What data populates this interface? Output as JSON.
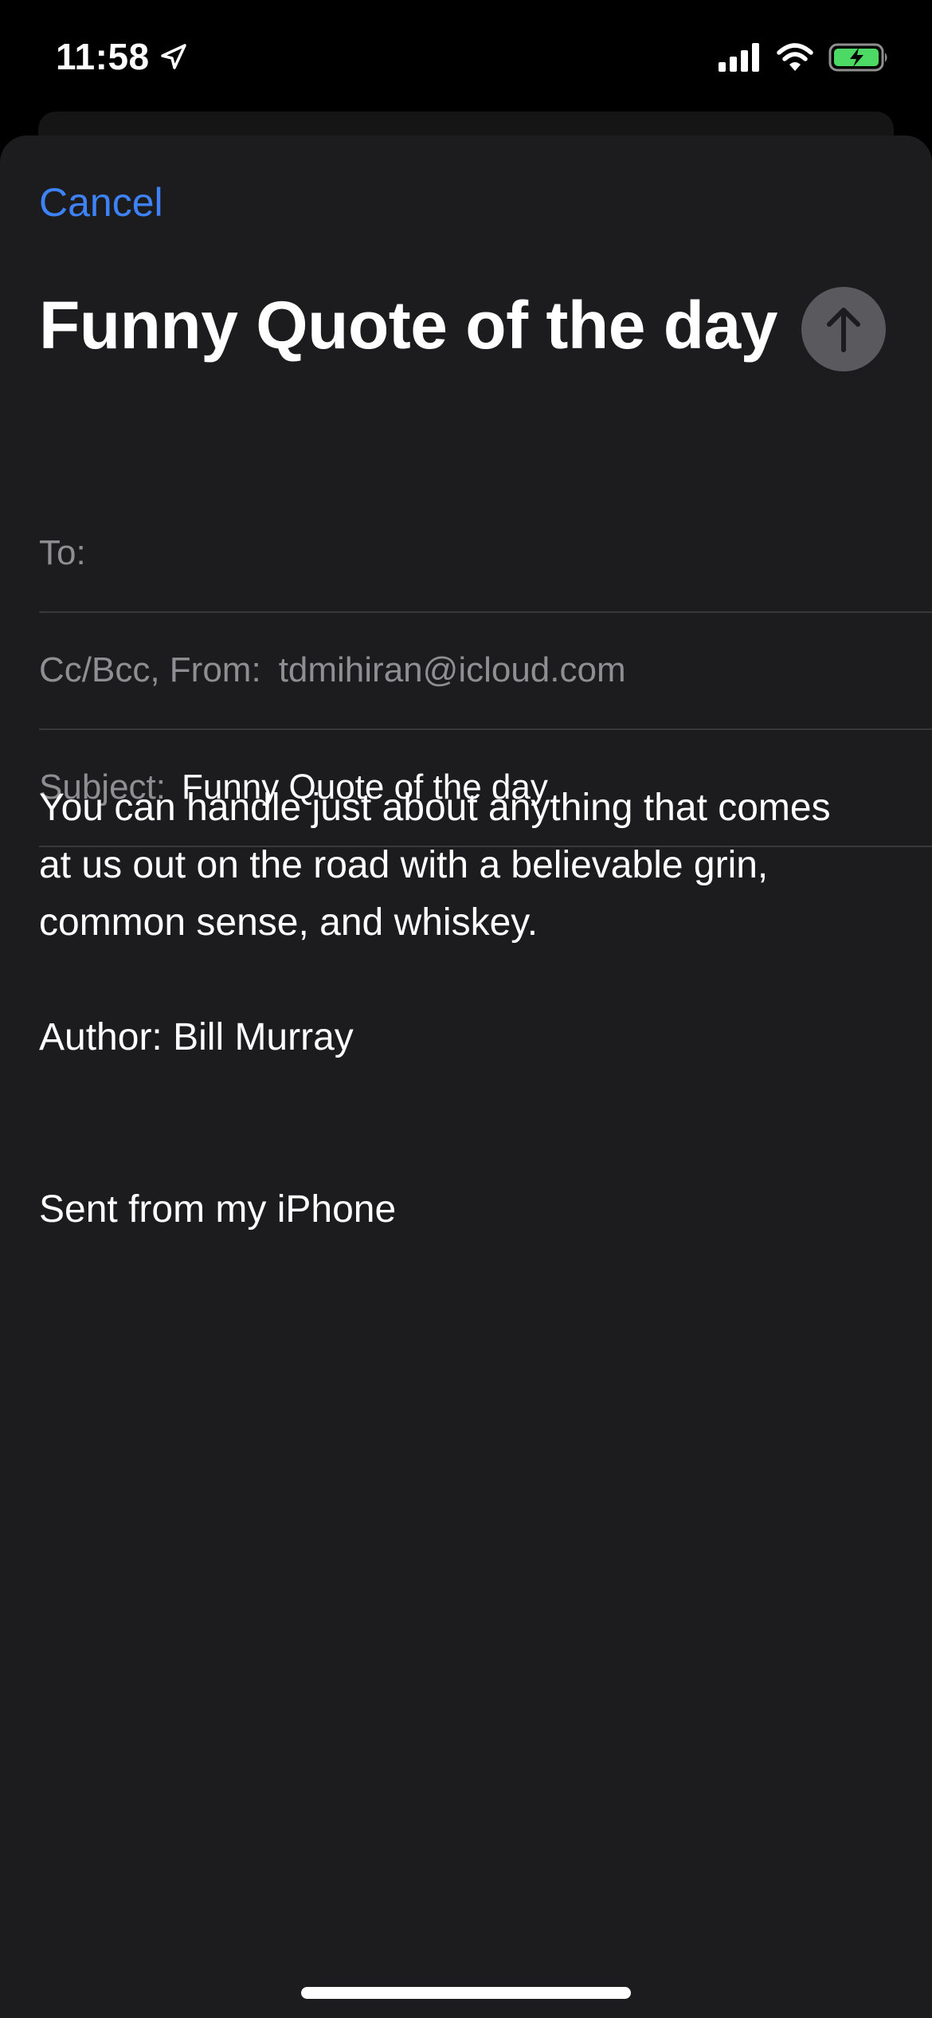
{
  "status_bar": {
    "time": "11:58",
    "location_icon": "location-arrow-icon",
    "signal_icon": "cellular-signal-icon",
    "wifi_icon": "wifi-icon",
    "battery_icon": "battery-charging-icon",
    "battery_color": "#4cd964"
  },
  "compose": {
    "cancel_label": "Cancel",
    "title": "Funny Quote of the day",
    "send_icon": "arrow-up-icon",
    "fields": {
      "to_label": "To:",
      "to_value": "",
      "from_label": "Cc/Bcc, From:",
      "from_value": "tdmihiran@icloud.com",
      "subject_label": "Subject:",
      "subject_value": "Funny Quote of the day"
    },
    "body": {
      "line1": "You can handle just about anything that comes",
      "line2": "at us out on the road with a believable grin,",
      "line3": "common sense, and whiskey.",
      "author": "Author: Bill Murray",
      "signature": "Sent from my iPhone"
    }
  },
  "colors": {
    "accent": "#3d82f6",
    "sheet_background": "#1c1c1e",
    "secondary_text": "#8e8e93",
    "send_button": "#59595e"
  }
}
